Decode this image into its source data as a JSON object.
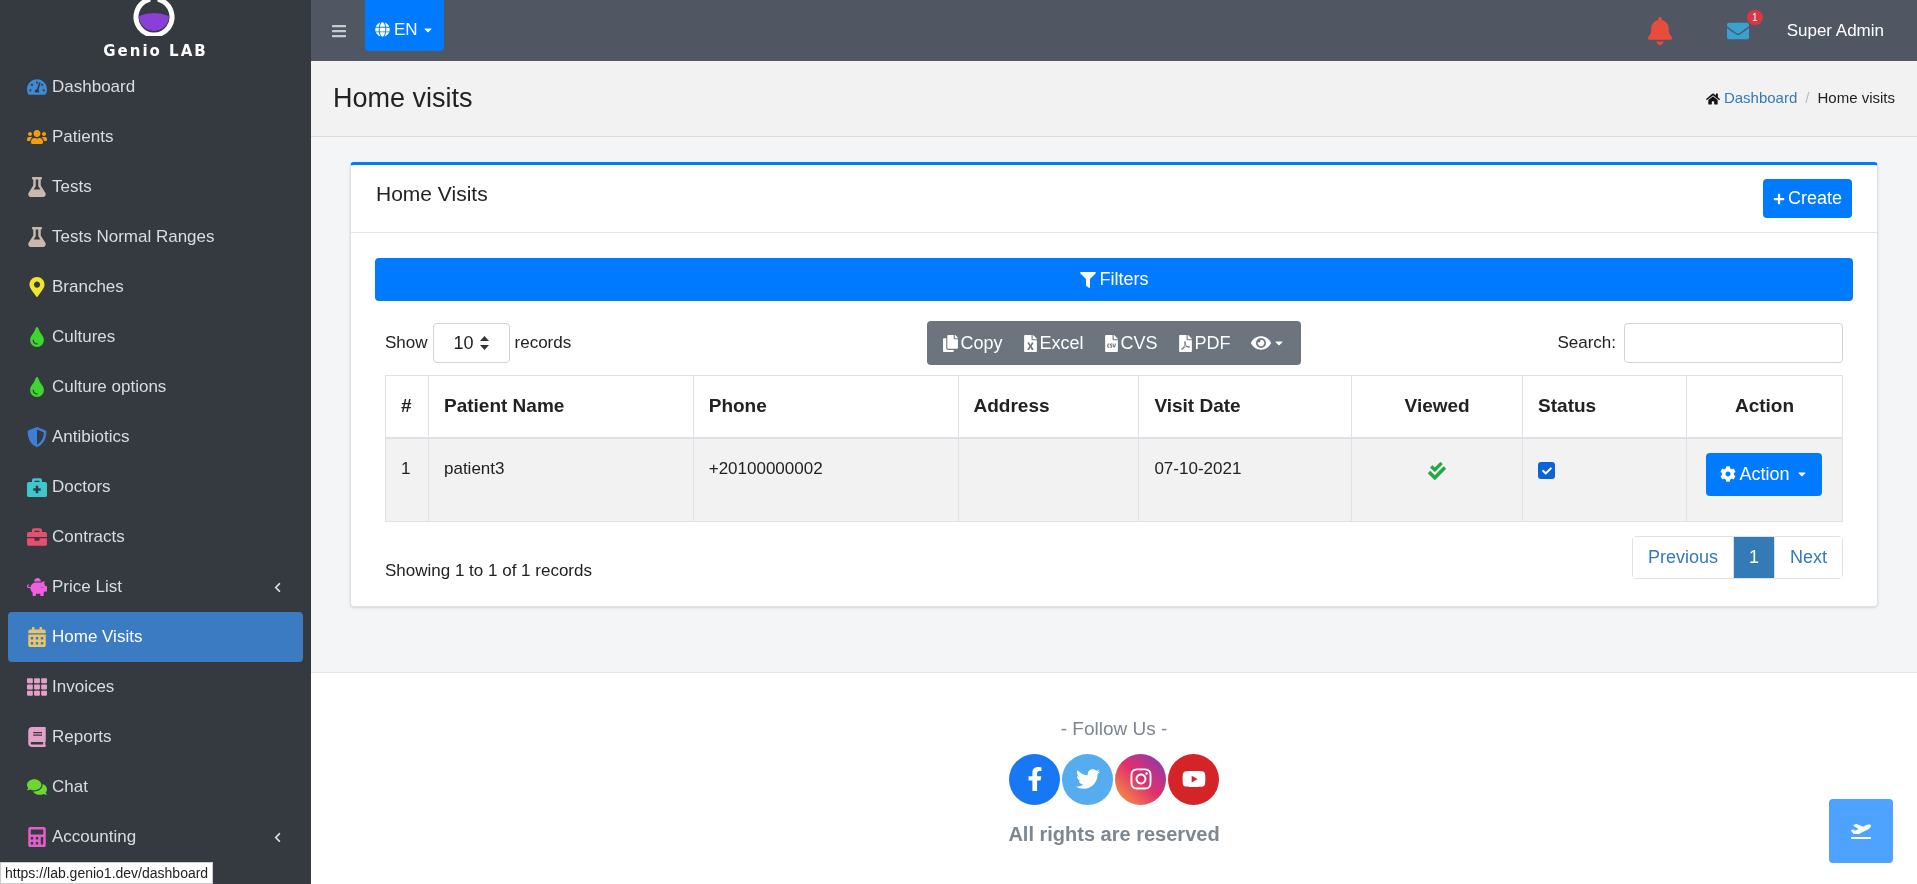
{
  "sidebar": {
    "logo_text": "Genio LAB",
    "items": [
      {
        "label": "Dashboard",
        "kind": "gauge",
        "color": "#3d8bd4",
        "selected": false,
        "expandable": false
      },
      {
        "label": "Patients",
        "kind": "users",
        "color": "#f39c12",
        "selected": false,
        "expandable": false
      },
      {
        "label": "Tests",
        "kind": "flask",
        "color": "#c9b8ae",
        "selected": false,
        "expandable": false
      },
      {
        "label": "Tests Normal Ranges",
        "kind": "flask",
        "color": "#c9b8ae",
        "selected": false,
        "expandable": false
      },
      {
        "label": "Branches",
        "kind": "pin",
        "color": "#f1e72a",
        "selected": false,
        "expandable": false
      },
      {
        "label": "Cultures",
        "kind": "drop",
        "color": "#3fd62f",
        "selected": false,
        "expandable": false
      },
      {
        "label": "Culture options",
        "kind": "drop",
        "color": "#3fd62f",
        "selected": false,
        "expandable": false
      },
      {
        "label": "Antibiotics",
        "kind": "shield",
        "color": "#3d7fd8",
        "selected": false,
        "expandable": false
      },
      {
        "label": "Doctors",
        "kind": "medkit",
        "color": "#3ec7cf",
        "selected": false,
        "expandable": false
      },
      {
        "label": "Contracts",
        "kind": "briefcase",
        "color": "#e84f6f",
        "selected": false,
        "expandable": false
      },
      {
        "label": "Price List",
        "kind": "piggy",
        "color": "#f25ee0",
        "selected": false,
        "expandable": true
      },
      {
        "label": "Home Visits",
        "kind": "calendar",
        "color": "#e8c46a",
        "selected": true,
        "expandable": false
      },
      {
        "label": "Invoices",
        "kind": "grid",
        "color": "#e3a0c8",
        "selected": false,
        "expandable": false
      },
      {
        "label": "Reports",
        "kind": "book",
        "color": "#e3a0c8",
        "selected": false,
        "expandable": false
      },
      {
        "label": "Chat",
        "kind": "chat",
        "color": "#6dd62f",
        "selected": false,
        "expandable": false
      },
      {
        "label": "Accounting",
        "kind": "calculator",
        "color": "#e060c8",
        "selected": false,
        "expandable": true
      }
    ]
  },
  "header": {
    "language": "EN",
    "mail_count": "1",
    "user": "Super Admin"
  },
  "page": {
    "title": "Home visits",
    "separator": "/",
    "breadcrumb": [
      {
        "label": "Dashboard",
        "link": true
      },
      {
        "label": "Home visits",
        "link": false
      }
    ]
  },
  "card": {
    "title": "Home Visits",
    "create": "Create",
    "filters": "Filters",
    "length": {
      "before": "Show",
      "value": "10",
      "after": "records"
    },
    "exports": [
      {
        "label": "Copy",
        "kind": "copy"
      },
      {
        "label": "Excel",
        "kind": "excel"
      },
      {
        "label": "CVS",
        "kind": "csv"
      },
      {
        "label": "PDF",
        "kind": "pdf"
      }
    ],
    "search_label": "Search:",
    "table": {
      "columns": [
        "#",
        "Patient Name",
        "Phone",
        "Address",
        "Visit Date",
        "Viewed",
        "Status",
        "Action"
      ],
      "rows": [
        {
          "number": "1",
          "patient_name": "patient3",
          "phone": "+20100000002",
          "visit_date": "07-10-2021",
          "viewed": true,
          "status": true,
          "action": "Action"
        }
      ]
    },
    "info": "Showing 1 to 1 of 1 records",
    "pages": [
      {
        "label": "Previous",
        "selected": false
      },
      {
        "label": "1",
        "selected": true
      },
      {
        "label": "Next",
        "selected": false
      }
    ]
  },
  "footer": {
    "follow": "- Follow Us -",
    "socials": [
      {
        "kind": "facebook"
      },
      {
        "kind": "twitter"
      },
      {
        "kind": "instagram"
      },
      {
        "kind": "youtube"
      }
    ],
    "rights": "All rights are reserved"
  },
  "status_url": "https://lab.genio1.dev/dashboard"
}
